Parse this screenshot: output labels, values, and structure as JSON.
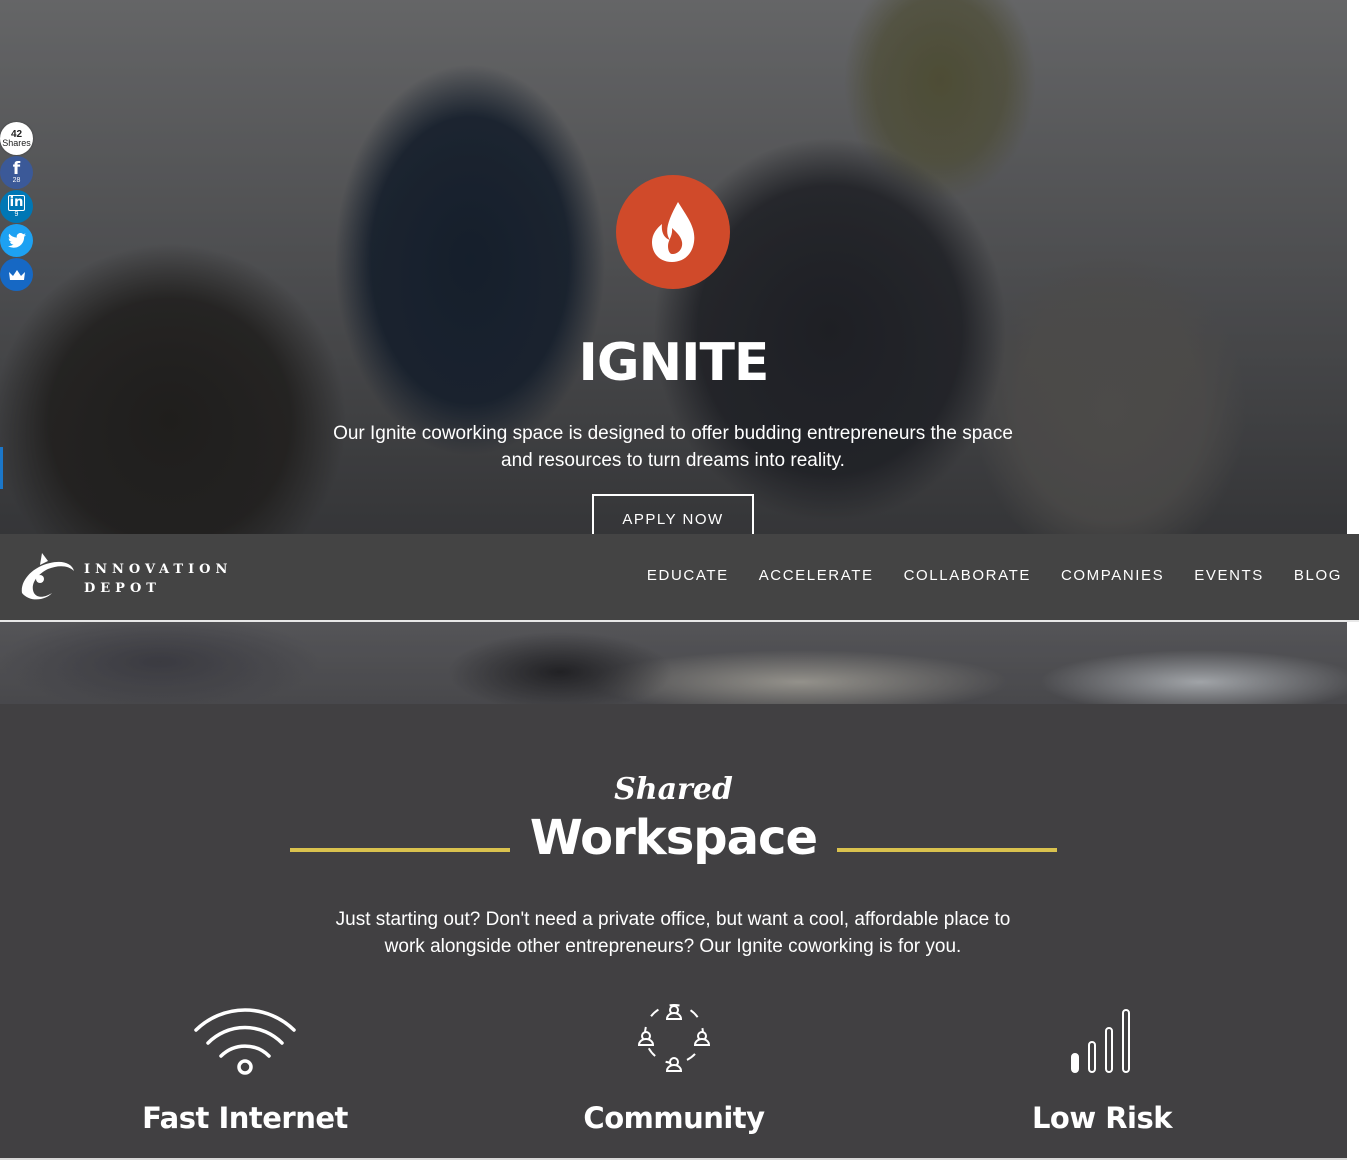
{
  "share": {
    "total": "42",
    "total_label": "Shares",
    "facebook_count": "28",
    "linkedin_count": "9",
    "icons": [
      "facebook-icon",
      "linkedin-icon",
      "twitter-icon",
      "sumome-crown-icon"
    ]
  },
  "hero": {
    "title": "IGNITE",
    "description": "Our Ignite coworking space is designed to offer budding entrepreneurs the space and resources to turn dreams into reality.",
    "button": "APPLY NOW",
    "logo_color": "#d04a2a"
  },
  "nav": {
    "logo_line1": "INNOVATION",
    "logo_line2": "DEPOT",
    "links": [
      "EDUCATE",
      "ACCELERATE",
      "COLLABORATE",
      "COMPANIES",
      "EVENTS",
      "BLOG"
    ]
  },
  "workspace": {
    "script_title": "Shared",
    "title": "Workspace",
    "description": "Just starting out? Don't need a private office, but want a cool, affordable place to work alongside other entrepreneurs? Our Ignite coworking is for you.",
    "accent_color": "#d9c24e",
    "features": [
      {
        "label": "Fast Internet",
        "icon": "wifi-icon"
      },
      {
        "label": "Community",
        "icon": "community-icon"
      },
      {
        "label": "Low Risk",
        "icon": "signal-bars-icon"
      }
    ]
  }
}
